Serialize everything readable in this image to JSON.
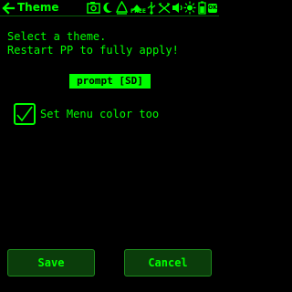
{
  "header": {
    "title": "Theme",
    "free_label": "FREE",
    "ok_label": "OK"
  },
  "main": {
    "instruction": "Select a theme.\nRestart PP to fully apply!",
    "selected_theme": "prompt [SD]",
    "checkbox": {
      "checked": true,
      "label": "Set Menu color too"
    }
  },
  "footer": {
    "save_label": "Save",
    "cancel_label": "Cancel"
  },
  "colors": {
    "foreground": "#00ff00",
    "background": "#000000",
    "button_fill": "#0b3d0b",
    "button_border": "#1d8a1d"
  }
}
